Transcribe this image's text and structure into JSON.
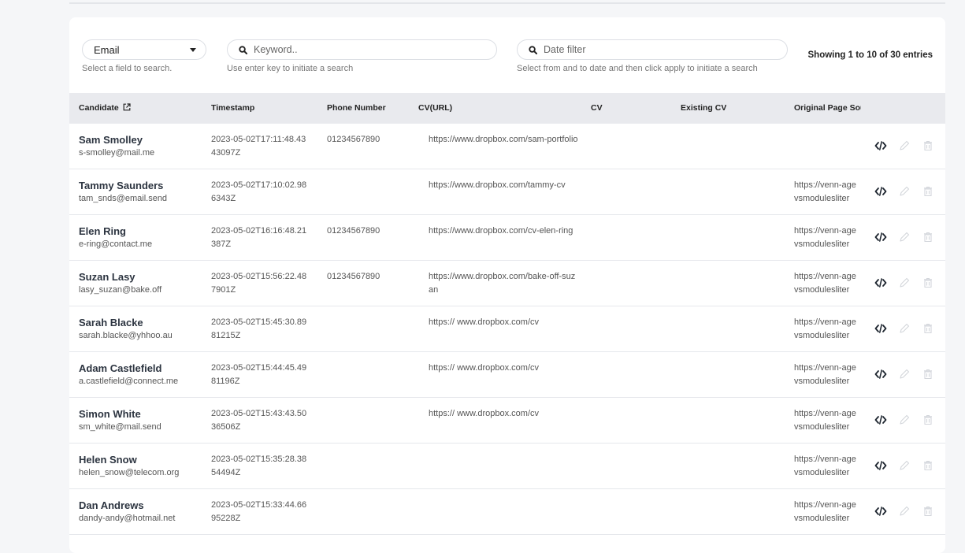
{
  "filters": {
    "field_select": {
      "value": "Email",
      "hint": "Select a field to search."
    },
    "keyword": {
      "placeholder": "Keyword..",
      "hint": "Use enter key to initiate a search"
    },
    "date": {
      "placeholder": "Date filter",
      "hint": "Select from and to date and then click apply to initiate a search"
    },
    "entries_text": "Showing 1 to 10 of 30 entries"
  },
  "table": {
    "columns": {
      "candidate": "Candidate",
      "timestamp": "Timestamp",
      "phone": "Phone Number",
      "cv_url": "CV(URL)",
      "cv": "CV",
      "existing_cv": "Existing CV",
      "original_page_source": "Original Page Sou"
    },
    "rows": [
      {
        "name": "Sam Smolley",
        "email": "s-smolley@mail.me",
        "timestamp": "2023-05-02T17:11:48.4343097Z",
        "phone": "01234567890",
        "cv_url": "https://www.dropbox.com/sam-portfolio",
        "source_1": "",
        "source_2": ""
      },
      {
        "name": "Tammy Saunders",
        "email": "tam_snds@email.send",
        "timestamp": "2023-05-02T17:10:02.986343Z",
        "phone": "",
        "cv_url": "https://www.dropbox.com/tammy-cv",
        "source_1": "https://venn-age",
        "source_2": "vsmodulesliter"
      },
      {
        "name": "Elen Ring",
        "email": "e-ring@contact.me",
        "timestamp": "2023-05-02T16:16:48.21387Z",
        "phone": "01234567890",
        "cv_url": "https://www.dropbox.com/cv-elen-ring",
        "source_1": "https://venn-age",
        "source_2": "vsmodulesliter"
      },
      {
        "name": "Suzan Lasy",
        "email": "lasy_suzan@bake.off",
        "timestamp": "2023-05-02T15:56:22.487901Z",
        "phone": "01234567890",
        "cv_url": "https://www.dropbox.com/bake-off-suzan",
        "source_1": "https://venn-age",
        "source_2": "vsmodulesliter"
      },
      {
        "name": "Sarah Blacke",
        "email": "sarah.blacke@yhhoo.au",
        "timestamp": "2023-05-02T15:45:30.8981215Z",
        "phone": "",
        "cv_url": "https:// www.dropbox.com/cv",
        "source_1": "https://venn-age",
        "source_2": "vsmodulesliter"
      },
      {
        "name": "Adam Castlefield",
        "email": "a.castlefield@connect.me",
        "timestamp": "2023-05-02T15:44:45.4981196Z",
        "phone": "",
        "cv_url": "https:// www.dropbox.com/cv",
        "source_1": "https://venn-age",
        "source_2": "vsmodulesliter"
      },
      {
        "name": "Simon White",
        "email": "sm_white@mail.send",
        "timestamp": "2023-05-02T15:43:43.5036506Z",
        "phone": "",
        "cv_url": "https:// www.dropbox.com/cv",
        "source_1": "https://venn-age",
        "source_2": "vsmodulesliter"
      },
      {
        "name": "Helen Snow",
        "email": "helen_snow@telecom.org",
        "timestamp": "2023-05-02T15:35:28.3854494Z",
        "phone": "",
        "cv_url": "",
        "source_1": "https://venn-age",
        "source_2": "vsmodulesliter"
      },
      {
        "name": "Dan Andrews",
        "email": "dandy-andy@hotmail.net",
        "timestamp": "2023-05-02T15:33:44.6695228Z",
        "phone": "",
        "cv_url": "",
        "source_1": "https://venn-age",
        "source_2": "vsmodulesliter"
      }
    ]
  },
  "icons": {
    "view_source": "code-icon",
    "edit": "pencil-icon",
    "delete": "trash-icon",
    "candidate_header": "external-link-icon",
    "search": "search-icon",
    "select": "caret-down-icon"
  }
}
